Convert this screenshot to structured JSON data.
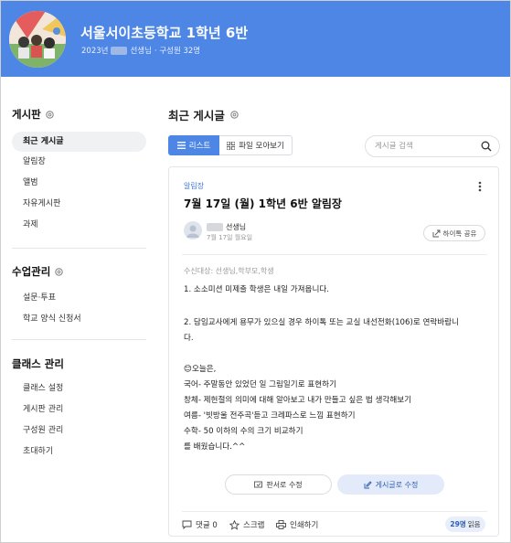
{
  "header": {
    "class_title": "서울서이초등학교 1학년 6반",
    "sub_year": "2023년",
    "sub_teacher": "선생님",
    "sub_members": "· 구성원 32명"
  },
  "sidebar": {
    "board_heading": "게시판",
    "board_items": [
      {
        "label": "최근 게시글",
        "active": true
      },
      {
        "label": "알림장"
      },
      {
        "label": "앨범"
      },
      {
        "label": "자유게시판"
      },
      {
        "label": "과제"
      }
    ],
    "class_heading": "수업관리",
    "class_items": [
      {
        "label": "설문·투표"
      },
      {
        "label": "학교 양식 신청서"
      }
    ],
    "manage_heading": "클래스 관리",
    "manage_items": [
      {
        "label": "클래스 설정"
      },
      {
        "label": "게시판 관리"
      },
      {
        "label": "구성원 관리"
      },
      {
        "label": "초대하기"
      }
    ]
  },
  "main": {
    "title": "최근 게시글",
    "view_list_label": "리스트",
    "view_files_label": "파일 모아보기",
    "search_placeholder": "게시글 검색"
  },
  "post": {
    "category": "알림장",
    "title": "7월 17일 (월) 1학년 6반 알림장",
    "author": "선생님",
    "date": "7월 17일 월요일",
    "share_label": "하이톡 공유",
    "recipients": "수신대상: 선생님,학부모,학생",
    "lines": [
      "1. 소소미션 미제출 학생은 내일 가져옵니다.",
      "2. 담임교사에게 용무가 있으실 경우 하이톡 또는 교실 내선전화(106)로 연락바랍니",
      "다.",
      "😊오늘은,",
      "국어- 주말동안 있었던 일 그림일기로 표현하기",
      "창체- 제헌절의 의미에 대해 알아보고 내가 만들고 싶은 법 생각해보기",
      "여름- '빗방울 전주곡'듣고 크레파스로 느낌 표현하기",
      "수학- 50 이하의 수의 크기 비교하기",
      "를 배웠습니다.^^"
    ],
    "edit_board_label": "판서로 수정",
    "edit_post_label": "게시글로 수정",
    "comments_label": "댓글 0",
    "scrap_label": "스크랩",
    "print_label": "인쇄하기",
    "read_count": "29명",
    "read_label": "읽음"
  },
  "colors": {
    "brand_blue": "#4e86e6",
    "accent_text": "#3e7ae0",
    "light_blue_bg": "#e3ebfa"
  }
}
